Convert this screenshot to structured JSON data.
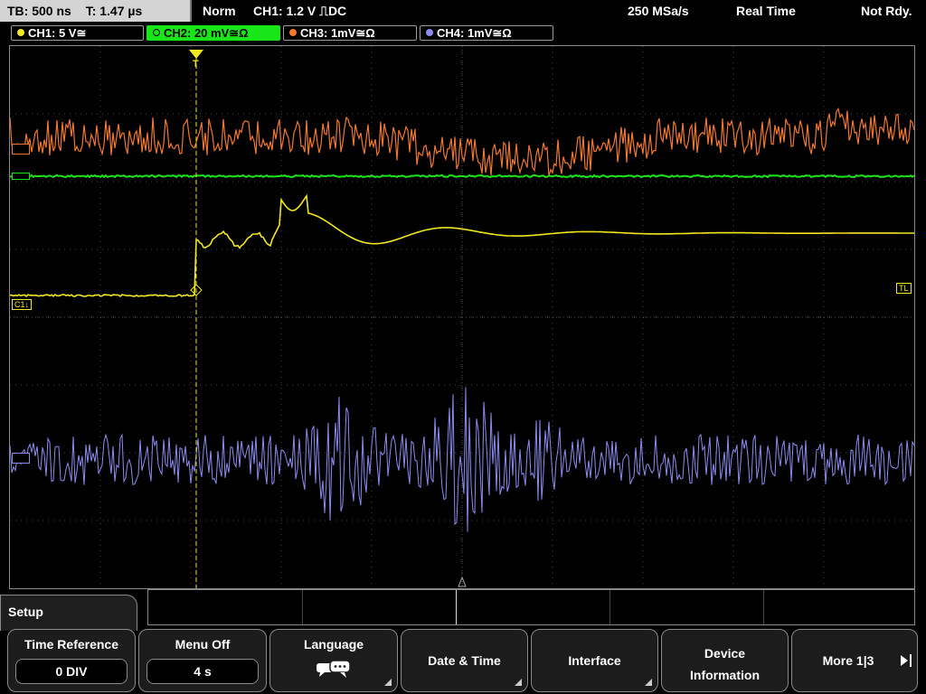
{
  "status": {
    "timebase": "TB: 500 ns",
    "trigger_time": "T: 1.47 µs",
    "acq_mode": "Norm",
    "trigger_info": "CH1: 1.2 V ⎍DC",
    "sample_rate": "250 MSa/s",
    "mode": "Real Time",
    "trigger_state": "Not Rdy."
  },
  "channels": [
    {
      "label": "CH1: 5 V≅",
      "color": "#f2e81e"
    },
    {
      "label": "CH2: 20 mV≅Ω",
      "color": "#19e619"
    },
    {
      "label": "CH3: 1mV≅Ω",
      "color": "#f07830"
    },
    {
      "label": "CH4: 1mV≅Ω",
      "color": "#8c8cf0"
    }
  ],
  "markers": {
    "ch1_ref": "C1↓",
    "trigger_level": "TL",
    "trigger_pos": "T"
  },
  "menu": {
    "title": "Setup",
    "softkeys": [
      {
        "label": "Time Reference",
        "value": "0 DIV"
      },
      {
        "label": "Menu Off",
        "value": "4 s"
      },
      {
        "label": "Language",
        "icon": "speech-bubble-icon"
      },
      {
        "label": "Date & Time"
      },
      {
        "label": "Interface"
      },
      {
        "label": "Device Information"
      },
      {
        "label": "More 1|3"
      }
    ]
  }
}
